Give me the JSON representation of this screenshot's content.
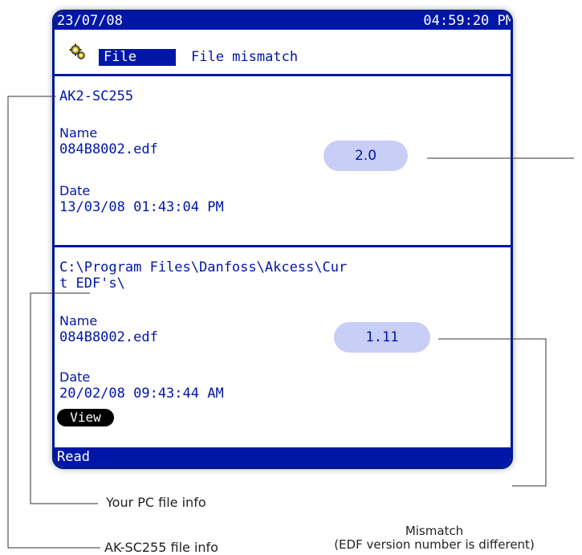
{
  "status_bar": {
    "date": "23/07/08",
    "time": "04:59:20 PM"
  },
  "menu": {
    "file_label": "File",
    "title": "File mismatch"
  },
  "controller_section": {
    "device_name": "AK2-SC255",
    "name_label": "Name",
    "file_name": "084B8002.edf",
    "date_label": "Date",
    "date_value": "13/03/08 01:43:04 PM",
    "version": "2.0"
  },
  "pc_section": {
    "path_line1": "C:\\Program Files\\Danfoss\\Akcess\\Cur",
    "path_line2": "t EDF's\\",
    "name_label": "Name",
    "file_name": "084B8002.edf",
    "date_label": "Date",
    "date_value": "20/02/08 09:43:44 AM",
    "version": "1.11"
  },
  "buttons": {
    "view_label": "View"
  },
  "bottom_bar": {
    "mode": "Read"
  },
  "callouts": {
    "pc_info": "Your PC file info",
    "mismatch_line1": "Mismatch",
    "mismatch_line2": "(EDF version number is different)",
    "controller_info": "AK-SC255 file info"
  },
  "colors": {
    "screen_blue": "#0016a8",
    "bubble": "#c8cef5"
  },
  "icons": {
    "menu": "gear-icon"
  }
}
